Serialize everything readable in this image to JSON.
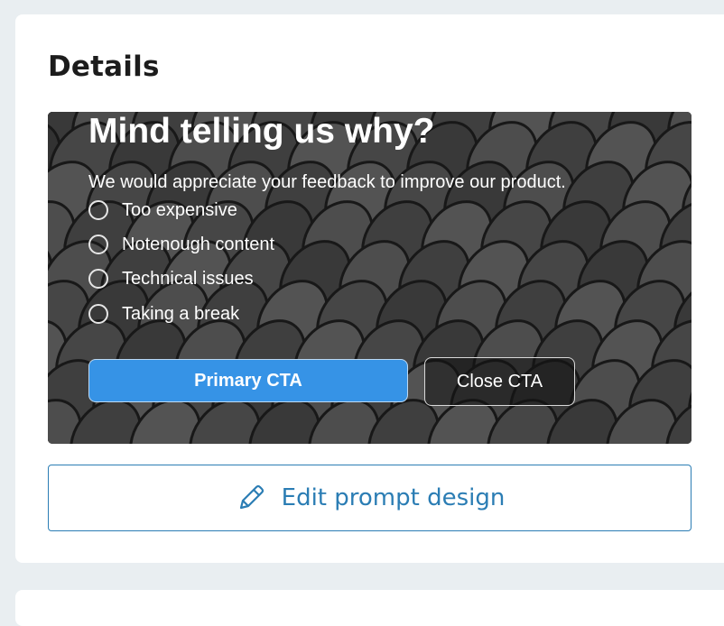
{
  "details": {
    "title": "Details",
    "preview": {
      "headline": "Mind telling us why?",
      "subtitle": "We would appreciate your feedback to improve our product.",
      "options": [
        {
          "label": "Too expensive"
        },
        {
          "label": "Notenough content"
        },
        {
          "label": "Technical issues"
        },
        {
          "label": "Taking a break"
        }
      ],
      "primary_cta": "Primary CTA",
      "close_cta": "Close CTA"
    },
    "edit_button": {
      "label": "Edit prompt design",
      "icon": "pencil-icon"
    }
  },
  "colors": {
    "page_background": "#e9eef1",
    "card_background": "#ffffff",
    "primary_cta": "#3693e6",
    "edit_accent": "#2b7db4"
  }
}
